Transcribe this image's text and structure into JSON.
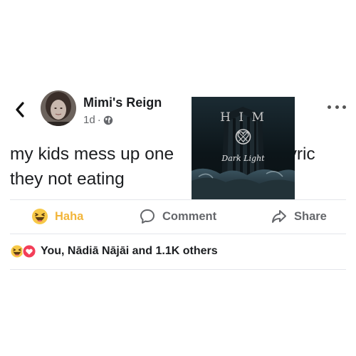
{
  "post": {
    "author": "Mimi's Reign",
    "time": "1d",
    "separator": "·",
    "text_line1_start": "my kids mess up one",
    "text_line1_end": "lyric",
    "text_line2": "they not eating"
  },
  "album": {
    "band_logo": "H I M",
    "album_title": "Dark Light"
  },
  "actions": {
    "haha_label": "Haha",
    "comment_label": "Comment",
    "share_label": "Share"
  },
  "reactions": {
    "summary": "You, Nādiā Nājāi and 1.1K others"
  },
  "colors": {
    "haha_accent": "#f2b53a",
    "muted_text": "#65676b",
    "love_red": "#f33e58"
  }
}
